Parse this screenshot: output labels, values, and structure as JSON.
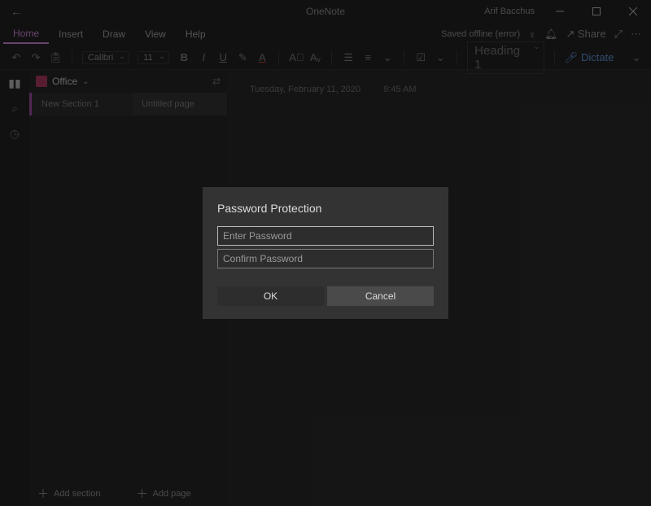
{
  "title": {
    "app": "OneNote",
    "user": "Arif Bacchus"
  },
  "menu": {
    "tabs": [
      "Home",
      "Insert",
      "Draw",
      "View",
      "Help"
    ],
    "active": 0,
    "status": "Saved offline (error)",
    "share": "Share"
  },
  "ribbon": {
    "font": "Calibri",
    "size": "11",
    "style_label": "Heading 1",
    "dictate": "Dictate"
  },
  "notebook": {
    "name": "Office",
    "section": "New Section 1",
    "page": "Untitled page",
    "add_section": "Add section",
    "add_page": "Add page"
  },
  "page": {
    "date": "Tuesday, February 11, 2020",
    "time": "9:45 AM"
  },
  "dialog": {
    "title": "Password Protection",
    "ph_enter": "Enter Password",
    "ph_confirm": "Confirm Password",
    "ok": "OK",
    "cancel": "Cancel"
  }
}
